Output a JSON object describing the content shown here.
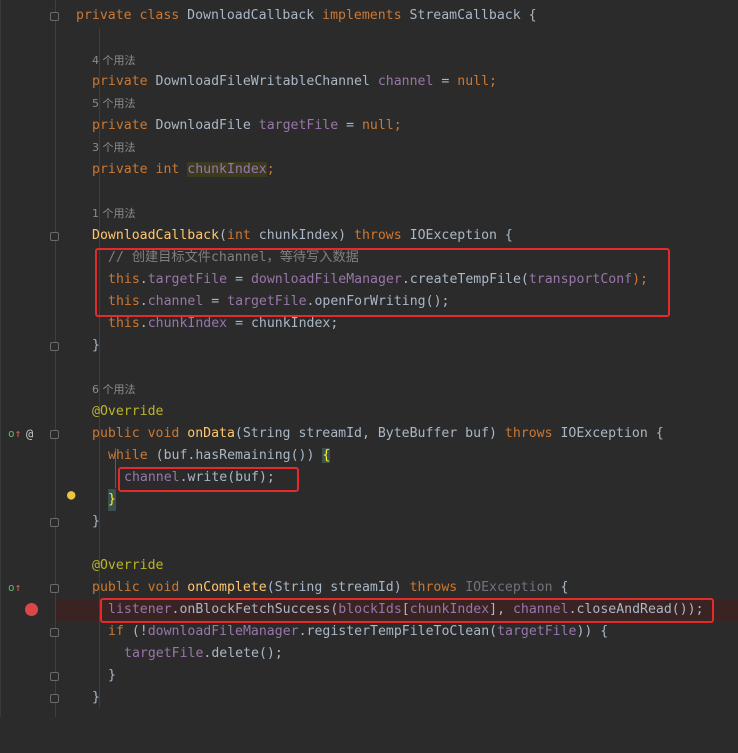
{
  "colors": {
    "background": "#2b2b2b",
    "keyword": "#cc7832",
    "field": "#9876aa",
    "method": "#ffc66d",
    "annotation": "#bbb529",
    "comment": "#808080",
    "highlight_box": "#e32b2b",
    "breakpoint": "#db4747"
  },
  "icons": {
    "override_icon": "overriding-method-icon",
    "at_icon": "annotation-at-icon",
    "bulb_icon": "intention-bulb-icon",
    "breakpoint_icon": "breakpoint-icon"
  },
  "hints": {
    "channel_usages": "4 个用法",
    "targetFile_usages": "5 个用法",
    "chunkIndex_usages": "3 个用法",
    "ctor_usages": "1 个用法",
    "onData_usages": "6 个用法"
  },
  "code": {
    "l1": {
      "t1": "private class ",
      "t2": "DownloadCallback ",
      "t3": "implements ",
      "t4": "StreamCallback {"
    },
    "l2": {
      "t1": "private ",
      "t2": "DownloadFileWritableChannel ",
      "t3": "channel",
      "t4": " = ",
      "t5": "null",
      "t6": ";"
    },
    "l3": {
      "t1": "private ",
      "t2": "DownloadFile ",
      "t3": "targetFile",
      "t4": " = ",
      "t5": "null",
      "t6": ";"
    },
    "l4": {
      "t1": "private ",
      "t2": "int ",
      "t3": "chunkIndex",
      "t4": ";"
    },
    "l5": {
      "t1": "DownloadCallback",
      "t2": "(",
      "t3": "int ",
      "t4": "chunkIndex) ",
      "t5": "throws ",
      "t6": "IOException {"
    },
    "l6": {
      "t1": "// 创建目标文件channel，等待写入数据"
    },
    "l7": {
      "t1": "this",
      "t2": ".",
      "t3": "targetFile",
      "t4": " = ",
      "t5": "downloadFileManager",
      "t6": ".createTempFile(",
      "t7": "transportConf",
      "t8": ");"
    },
    "l8": {
      "t1": "this",
      "t2": ".",
      "t3": "channel",
      "t4": " = ",
      "t5": "targetFile",
      "t6": ".openForWriting();"
    },
    "l9": {
      "t1": "this",
      "t2": ".",
      "t3": "chunkIndex",
      "t4": " = chunkIndex;"
    },
    "l10": {
      "t1": "}"
    },
    "l11": {
      "t1": "@Override"
    },
    "l12": {
      "t1": "public ",
      "t2": "void ",
      "t3": "onData",
      "t4": "(String streamId, ByteBuffer buf) ",
      "t5": "throws ",
      "t6": "IOException {"
    },
    "l13": {
      "t1": "while ",
      "t2": "(buf.hasRemaining()) ",
      "t3": "{"
    },
    "l14": {
      "t1": "channel",
      "t2": ".write(buf);"
    },
    "l15": {
      "t1": "}"
    },
    "l16": {
      "t1": "}"
    },
    "l17": {
      "t1": "@Override"
    },
    "l18": {
      "t1": "public ",
      "t2": "void ",
      "t3": "onComplete",
      "t4": "(String streamId) ",
      "t5": "throws ",
      "t6": "IOException",
      "t7": " {"
    },
    "l19": {
      "t1": "listener",
      "t2": ".onBlockFetchSuccess(",
      "t3": "blockIds",
      "t4": "[",
      "t5": "chunkIndex",
      "t6": "], ",
      "t7": "channel",
      "t8": ".closeAndRead());"
    },
    "l20": {
      "t1": "if ",
      "t2": "(!",
      "t3": "downloadFileManager",
      "t4": ".registerTempFileToClean(",
      "t5": "targetFile",
      "t6": ")) {"
    },
    "l21": {
      "t1": "targetFile",
      "t2": ".delete();"
    },
    "l22": {
      "t1": "}"
    },
    "l23": {
      "t1": "}"
    }
  }
}
